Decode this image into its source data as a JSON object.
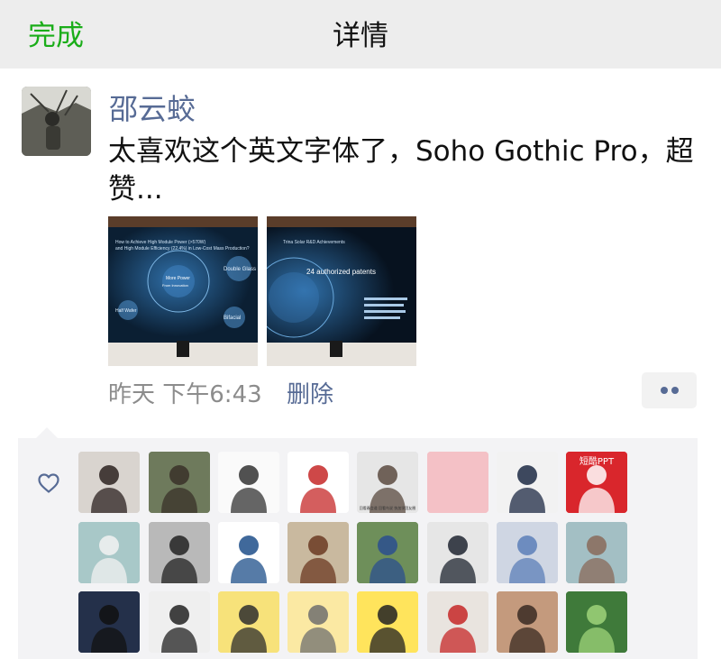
{
  "nav": {
    "done_label": "完成",
    "title": "详情"
  },
  "post": {
    "author": "邵云蛟",
    "text": "太喜欢这个英文字体了，Soho Gothic Pro，超赞...",
    "time": "昨天 下午6:43",
    "delete_label": "删除",
    "photos": [
      {
        "name": "photo-monitor-1",
        "screen_lines": [
          "How to Achieve High Module Power (>570W)",
          "and High Module Efficiency (22.4%) in Low-Cost Mass Production?"
        ],
        "labels": [
          "Double Glass",
          "Bifacial",
          "Half Wafer",
          "More Power",
          "From Innovation"
        ]
      },
      {
        "name": "photo-monitor-2",
        "screen_lines": [
          "Trina Solar R&D Achievements"
        ],
        "labels": [
          "24 authorized patents"
        ]
      }
    ]
  },
  "likes": {
    "icon": "heart-outline-icon",
    "rows": [
      [
        {
          "name": "liker-woman-white-dress",
          "bg": "#d9d4cf",
          "fg": "#2b2220"
        },
        {
          "name": "liker-man-camera",
          "bg": "#6e7a5c",
          "fg": "#3a3128"
        },
        {
          "name": "liker-cartoon-duck",
          "bg": "#fafafa",
          "fg": "#333333"
        },
        {
          "name": "liker-christmas-cartoon",
          "bg": "#ffffff",
          "fg": "#c62828"
        },
        {
          "name": "liker-group-photo",
          "bg": "#e6e6e6",
          "fg": "#5a4a3f",
          "caption": "回看春会道 回看鸟说  快加学团友圈"
        },
        {
          "name": "liker-pink-blank",
          "bg": "#f4c1c6",
          "fg": "#f4c1c6"
        },
        {
          "name": "liker-man-suit",
          "bg": "#f2f2f2",
          "fg": "#1d2a44"
        },
        {
          "name": "liker-duanku-ppt",
          "bg": "#d9262c",
          "fg": "#ffffff",
          "caption": "短酷PPT"
        }
      ],
      [
        {
          "name": "liker-woman-gown",
          "bg": "#a8c8c8",
          "fg": "#f2f2f2"
        },
        {
          "name": "liker-man-beach",
          "bg": "#b9b9b9",
          "fg": "#222222"
        },
        {
          "name": "liker-glasses-sketch",
          "bg": "#ffffff",
          "fg": "#1e4f8a"
        },
        {
          "name": "liker-man-uniform",
          "bg": "#c9b99f",
          "fg": "#6b3a22"
        },
        {
          "name": "liker-woman-denim",
          "bg": "#6e8f5a",
          "fg": "#2c4f8f"
        },
        {
          "name": "liker-man-tie",
          "bg": "#e6e6e6",
          "fg": "#1f2530"
        },
        {
          "name": "liker-woman-blue-shirt",
          "bg": "#cfd6e3",
          "fg": "#5c7fb8"
        },
        {
          "name": "liker-baby-costume",
          "bg": "#a3bfc4",
          "fg": "#8a6a5a"
        }
      ],
      [
        {
          "name": "liker-girl-dark",
          "bg": "#24304a",
          "fg": "#111111"
        },
        {
          "name": "liker-manga-gun",
          "bg": "#efefef",
          "fg": "#222222"
        },
        {
          "name": "liker-cartoon-boy-yellow",
          "bg": "#f7e27a",
          "fg": "#2e2e2e"
        },
        {
          "name": "liker-cartoon-bird",
          "bg": "#fbe9a3",
          "fg": "#6f6f6f"
        },
        {
          "name": "liker-cartoon-laugh",
          "bg": "#ffe45c",
          "fg": "#222222"
        },
        {
          "name": "liker-parrot-mask",
          "bg": "#e9e4df",
          "fg": "#c62828"
        },
        {
          "name": "liker-woman-sitting",
          "bg": "#c49a7d",
          "fg": "#3a2a22"
        },
        {
          "name": "liker-green-plant",
          "bg": "#3f7a3a",
          "fg": "#9fd47a"
        }
      ]
    ]
  }
}
